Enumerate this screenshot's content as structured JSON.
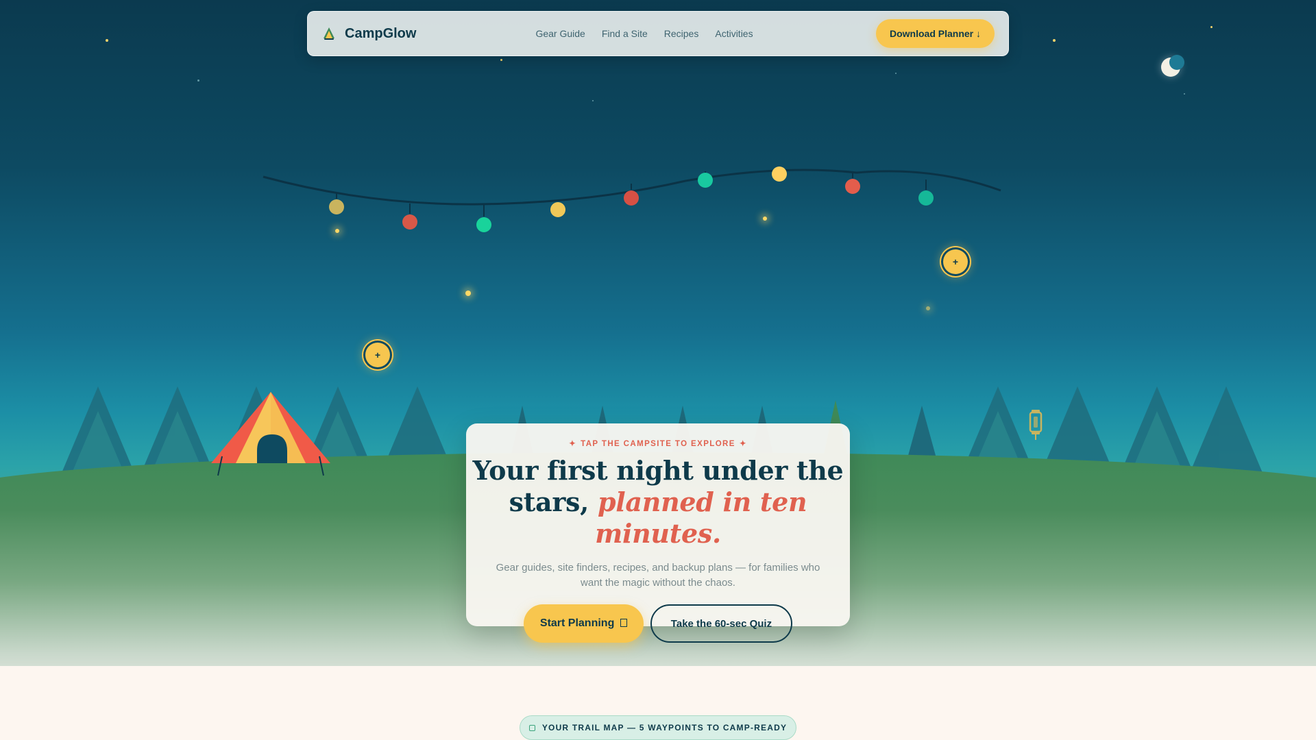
{
  "header": {
    "brand": "CampGlow",
    "nav": [
      "Gear Guide",
      "Find a Site",
      "Recipes",
      "Activities"
    ],
    "download_label": "Download Planner ↓"
  },
  "hero": {
    "eyebrow": "TAP THE CAMPSITE TO EXPLORE",
    "eyebrow_icon": "✦",
    "headline_main": "Your first night under the stars, ",
    "headline_accent": "planned in ten minutes.",
    "subtext": "Gear guides, site finders, recipes, and backup plans — for families who want the magic without the chaos.",
    "primary_cta": "Start Planning",
    "secondary_cta": "Take the 60-sec Quiz"
  },
  "hotspots": [
    "+",
    "+"
  ],
  "trail": {
    "label": "YOUR TRAIL MAP — 5 WAYPOINTS TO CAMP-READY"
  },
  "colors": {
    "sky_top": "#0b3a4f",
    "accent_yellow": "#f8c64e",
    "accent_coral": "#e0614f",
    "text_dark": "#0e3a4a",
    "grass": "#3f8a58"
  }
}
